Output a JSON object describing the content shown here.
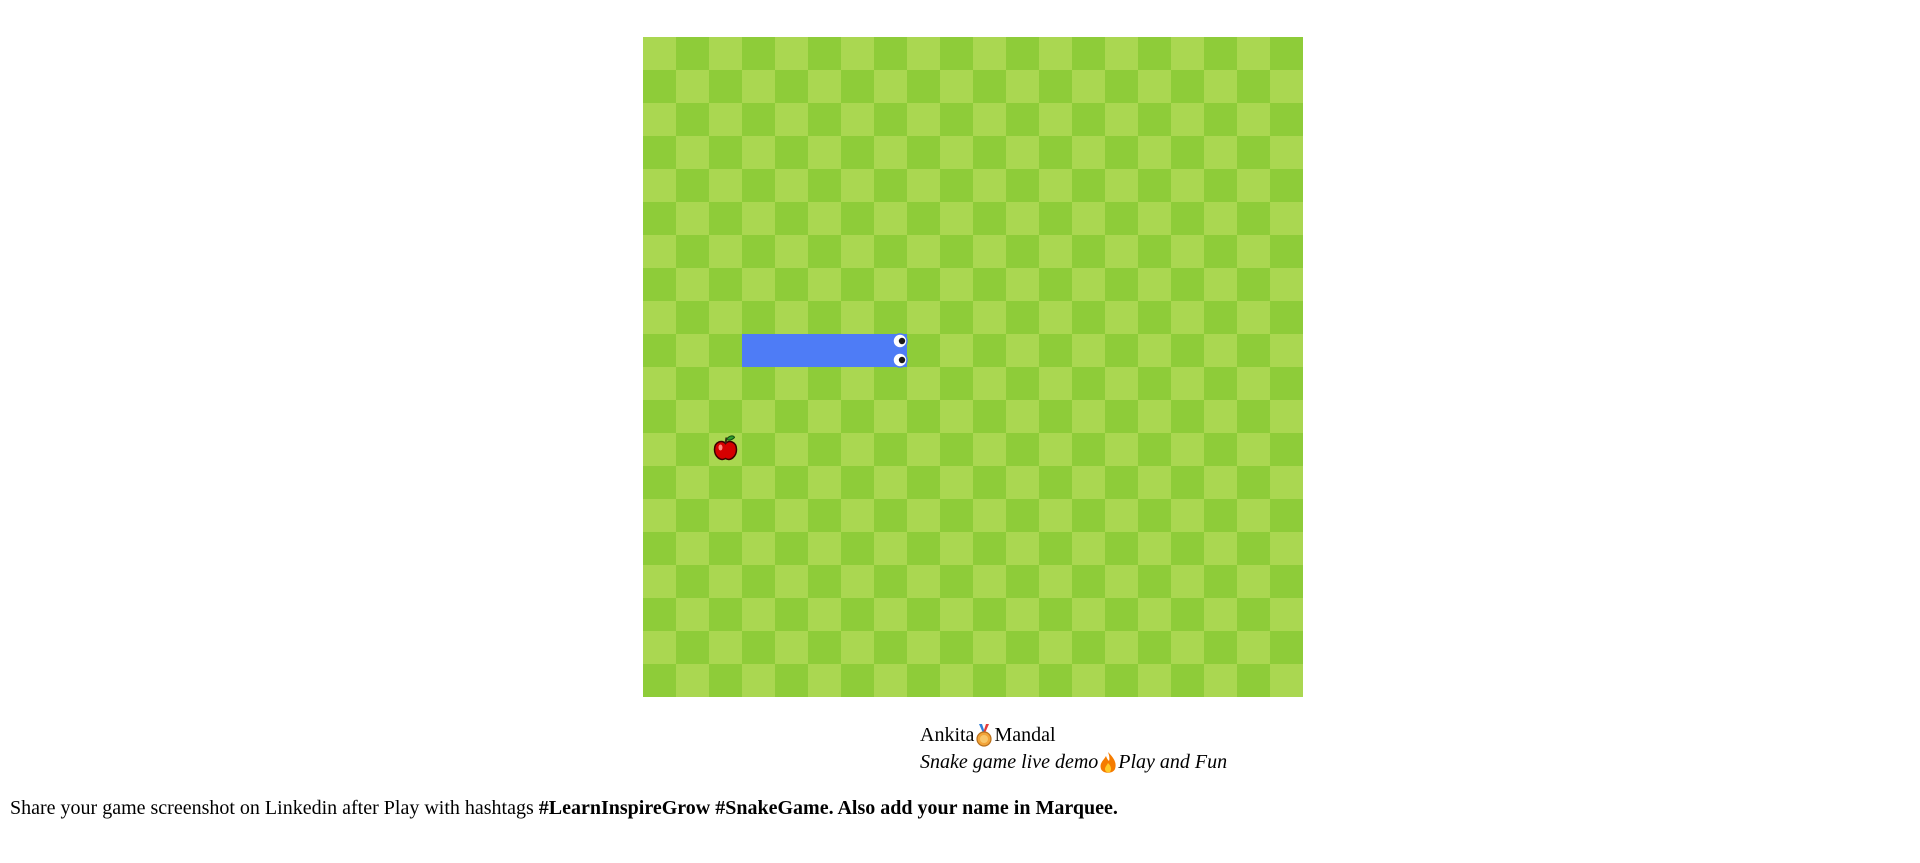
{
  "game": {
    "board": {
      "cols": 20,
      "rows": 20,
      "color_light": "#aad751",
      "color_dark": "#8ecc39"
    },
    "snake": {
      "color": "#4e7cf6",
      "direction": "right",
      "cells": [
        [
          3,
          9
        ],
        [
          4,
          9
        ],
        [
          5,
          9
        ],
        [
          6,
          9
        ],
        [
          7,
          9
        ]
      ]
    },
    "apple": {
      "cell": [
        2,
        12
      ],
      "color": "#d50000"
    }
  },
  "marquee": {
    "name_first": "Ankita",
    "medal_icon": "medal-icon",
    "name_last": "Mandal",
    "subtitle": "Snake game live demo",
    "fire_icon": "fire-icon",
    "subtitle_end": "Play and Fun"
  },
  "share": {
    "text": "Share your game screenshot on Linkedin after Play with hashtags ",
    "bold": "#LearnInspireGrow #SnakeGame. Also add your name in Marquee."
  }
}
